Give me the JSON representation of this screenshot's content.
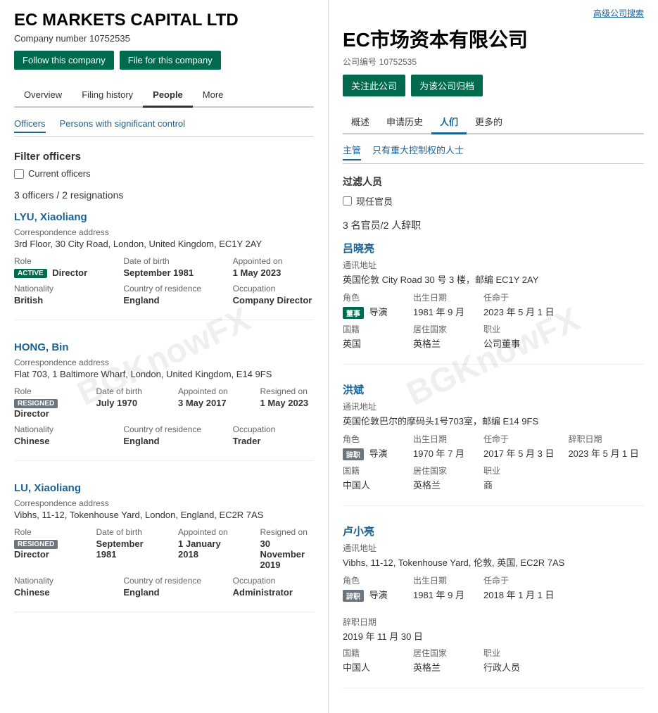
{
  "left": {
    "company_title": "EC MARKETS CAPITAL LTD",
    "company_number_label": "Company number",
    "company_number": "10752535",
    "buttons": {
      "follow": "Follow this company",
      "file": "File for this company"
    },
    "tabs": [
      {
        "label": "Overview",
        "active": false
      },
      {
        "label": "Filing history",
        "active": false
      },
      {
        "label": "People",
        "active": true
      },
      {
        "label": "More",
        "active": false
      }
    ],
    "sub_tabs": [
      {
        "label": "Officers",
        "active": true
      },
      {
        "label": "Persons with significant control",
        "active": false
      }
    ],
    "filter": {
      "title": "Filter officers",
      "checkbox_label": "Current officers"
    },
    "officers_count": "3 officers / 2 resignations",
    "watermark": "BGKnowFX",
    "officers": [
      {
        "name": "LYU, Xiaoliang",
        "address_label": "Correspondence address",
        "address": "3rd Floor, 30 City Road, London, United Kingdom, EC1Y 2AY",
        "role_label": "Role",
        "role_badge": "ACTIVE",
        "role_badge_type": "active",
        "role_value": "Director",
        "dob_label": "Date of birth",
        "dob_value": "September 1981",
        "appointed_label": "Appointed on",
        "appointed_value": "1 May 2023",
        "resigned_label": "",
        "resigned_value": "",
        "nationality_label": "Nationality",
        "nationality_value": "British",
        "residence_label": "Country of residence",
        "residence_value": "England",
        "occupation_label": "Occupation",
        "occupation_value": "Company Director"
      },
      {
        "name": "HONG, Bin",
        "address_label": "Correspondence address",
        "address": "Flat 703, 1 Baltimore Wharf, London, United Kingdom, E14 9FS",
        "role_label": "Role",
        "role_badge": "RESIGNED",
        "role_badge_type": "resigned",
        "role_value": "Director",
        "dob_label": "Date of birth",
        "dob_value": "July 1970",
        "appointed_label": "Appointed on",
        "appointed_value": "3 May 2017",
        "resigned_label": "Resigned on",
        "resigned_value": "1 May 2023",
        "nationality_label": "Nationality",
        "nationality_value": "Chinese",
        "residence_label": "Country of residence",
        "residence_value": "England",
        "occupation_label": "Occupation",
        "occupation_value": "Trader"
      },
      {
        "name": "LU, Xiaoliang",
        "address_label": "Correspondence address",
        "address": "Vibhs, 11-12, Tokenhouse Yard, London, England, EC2R 7AS",
        "role_label": "Role",
        "role_badge": "RESIGNED",
        "role_badge_type": "resigned",
        "role_value": "Director",
        "dob_label": "Date of birth",
        "dob_value": "September 1981",
        "appointed_label": "Appointed on",
        "appointed_value": "1 January 2018",
        "resigned_label": "Resigned on",
        "resigned_value": "30 November 2019",
        "nationality_label": "Nationality",
        "nationality_value": "Chinese",
        "residence_label": "Country of residence",
        "residence_value": "England",
        "occupation_label": "Occupation",
        "occupation_value": "Administrator"
      }
    ]
  },
  "right": {
    "advanced_search": "高级公司搜索",
    "company_title": "EC市场资本有限公司",
    "company_number_prefix": "公司编号",
    "company_number": "10752535",
    "buttons": {
      "follow": "关注此公司",
      "file": "为该公司归档"
    },
    "tabs": [
      {
        "label": "概述",
        "active": false
      },
      {
        "label": "申请历史",
        "active": false
      },
      {
        "label": "人们",
        "active": true
      },
      {
        "label": "更多的",
        "active": false
      }
    ],
    "sub_tabs": [
      {
        "label": "主管",
        "active": true
      },
      {
        "label": "只有重大控制权的人士",
        "active": false
      }
    ],
    "filter": {
      "title": "过滤人员",
      "checkbox_label": "现任官员"
    },
    "officers_count": "3 名官员/2 人辞职",
    "watermark": "BGKnowFX",
    "officers": [
      {
        "name": "吕晓亮",
        "address_label": "通讯地址",
        "address": "英国伦敦 City Road 30 号 3 楼，邮编 EC1Y 2AY",
        "role_label": "角色",
        "role_badge": "董事",
        "role_badge_type": "active",
        "role_value": "导演",
        "dob_label": "出生日期",
        "dob_value": "1981 年 9 月",
        "appointed_label": "任命于",
        "appointed_value": "2023 年 5 月 1 日",
        "resigned_label": "",
        "resigned_value": "",
        "nationality_label": "国籍",
        "nationality_value": "英国",
        "residence_label": "居住国家",
        "residence_value": "英格兰",
        "occupation_label": "职业",
        "occupation_value": "公司董事"
      },
      {
        "name": "洪斌",
        "address_label": "通讯地址",
        "address": "英国伦敦巴尔的摩码头1号703室，邮编 E14 9FS",
        "role_label": "角色",
        "role_badge": "辞职",
        "role_badge_type": "resigned",
        "role_value": "导演",
        "dob_label": "出生日期",
        "dob_value": "1970 年 7 月",
        "appointed_label": "任命于",
        "appointed_value": "2017 年 5 月 3 日",
        "resigned_label": "辞职日期",
        "resigned_value": "2023 年 5 月 1 日",
        "nationality_label": "国籍",
        "nationality_value": "中国人",
        "residence_label": "居住国家",
        "residence_value": "英格兰",
        "occupation_label": "职业",
        "occupation_value": "商"
      },
      {
        "name": "卢小亮",
        "address_label": "通讯地址",
        "address": "Vibhs, 11-12, Tokenhouse Yard, 伦敦, 英国, EC2R 7AS",
        "role_label": "角色",
        "role_badge": "辞职",
        "role_badge_type": "resigned",
        "role_value": "导演",
        "dob_label": "出生日期",
        "dob_value": "1981 年 9 月",
        "appointed_label": "任命于",
        "appointed_value": "2018 年 1 月 1 日",
        "resigned_label": "辞职日期",
        "resigned_value": "2019 年 11 月 30 日",
        "nationality_label": "国籍",
        "nationality_value": "中国人",
        "residence_label": "居住国家",
        "residence_value": "英格兰",
        "occupation_label": "职业",
        "occupation_value": "行政人员"
      }
    ]
  }
}
